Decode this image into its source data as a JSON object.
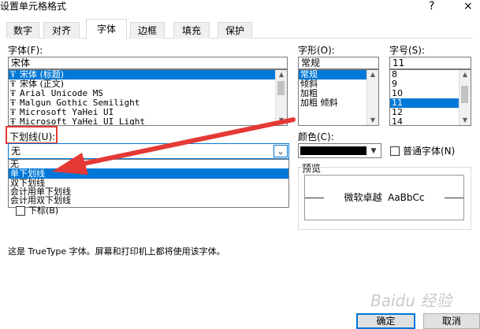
{
  "window": {
    "title": "设置单元格格式",
    "help_label": "?",
    "close_label": "×"
  },
  "tabs": [
    {
      "label": "数字"
    },
    {
      "label": "对齐"
    },
    {
      "label": "字体"
    },
    {
      "label": "边框"
    },
    {
      "label": "填充"
    },
    {
      "label": "保护"
    }
  ],
  "font": {
    "label": "字体(F):",
    "value": "宋体",
    "items": [
      {
        "label": "宋体 (标题)"
      },
      {
        "label": "宋体 (正文)"
      },
      {
        "label": "Arial Unicode MS"
      },
      {
        "label": "Malgun Gothic Semilight"
      },
      {
        "label": "Microsoft YaHei UI"
      },
      {
        "label": "Microsoft YaHei UI Light"
      }
    ],
    "type_icon_glyph": "Ŧ"
  },
  "style": {
    "label": "字形(O):",
    "value": "常规",
    "items": [
      {
        "label": "常规"
      },
      {
        "label": "倾斜"
      },
      {
        "label": "加粗"
      },
      {
        "label": "加粗 倾斜"
      }
    ]
  },
  "size": {
    "label": "字号(S):",
    "value": "11",
    "items": [
      {
        "label": "8"
      },
      {
        "label": "9"
      },
      {
        "label": "10"
      },
      {
        "label": "11"
      },
      {
        "label": "12"
      },
      {
        "label": "14"
      }
    ]
  },
  "underline": {
    "label": "下划线(U):",
    "value": "无",
    "options": [
      {
        "label": "无"
      },
      {
        "label": "单下划线"
      },
      {
        "label": "双下划线"
      },
      {
        "label": "会计用单下划线"
      },
      {
        "label": "会计用双下划线"
      }
    ],
    "dropdown_glyph": "⌄"
  },
  "subscript_label": "下标(B)",
  "color": {
    "label": "颜色(C):",
    "value_color": "#000000",
    "normal_font_label": "普通字体(N)"
  },
  "preview": {
    "label": "预览",
    "text": "微软卓越  AaBbCc"
  },
  "info_text": "这是 TrueType 字体。屏幕和打印机上都将使用该字体。",
  "buttons": {
    "ok": "确定",
    "cancel": "取消"
  },
  "watermark": {
    "text": "Baidu 经验"
  },
  "colors": {
    "accent": "#0078d7",
    "annotation_red": "#e53935"
  }
}
